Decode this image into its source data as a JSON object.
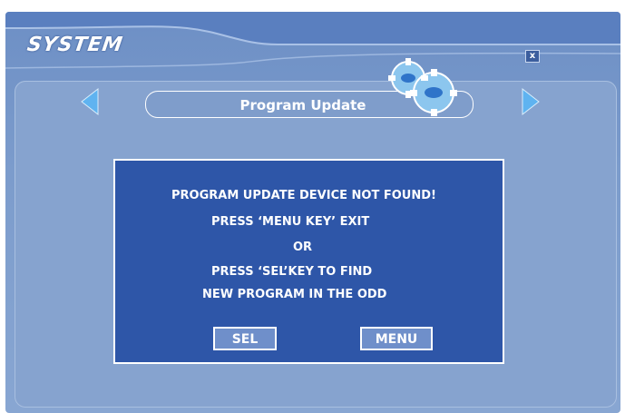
{
  "window": {
    "title": "SYSTEM",
    "close_label": "x"
  },
  "nav": {
    "section_title": "Program Update",
    "prev_icon": "left-arrow-icon",
    "next_icon": "right-arrow-icon",
    "decor_icon": "gears-icon"
  },
  "dialog": {
    "lines": [
      "PROGRAM UPDATE DEVICE NOT FOUND!",
      "PRESS ‘MENU KEY’ EXIT",
      "OR",
      "PRESS ‘SEL’KEY TO FIND",
      "NEW PROGRAM IN THE ODD"
    ],
    "sel_label": "SEL",
    "menu_label": "MENU"
  },
  "colors": {
    "panel": "#86a3cf",
    "dialog": "#2e56a8",
    "arrow": "#5fb3f0"
  }
}
